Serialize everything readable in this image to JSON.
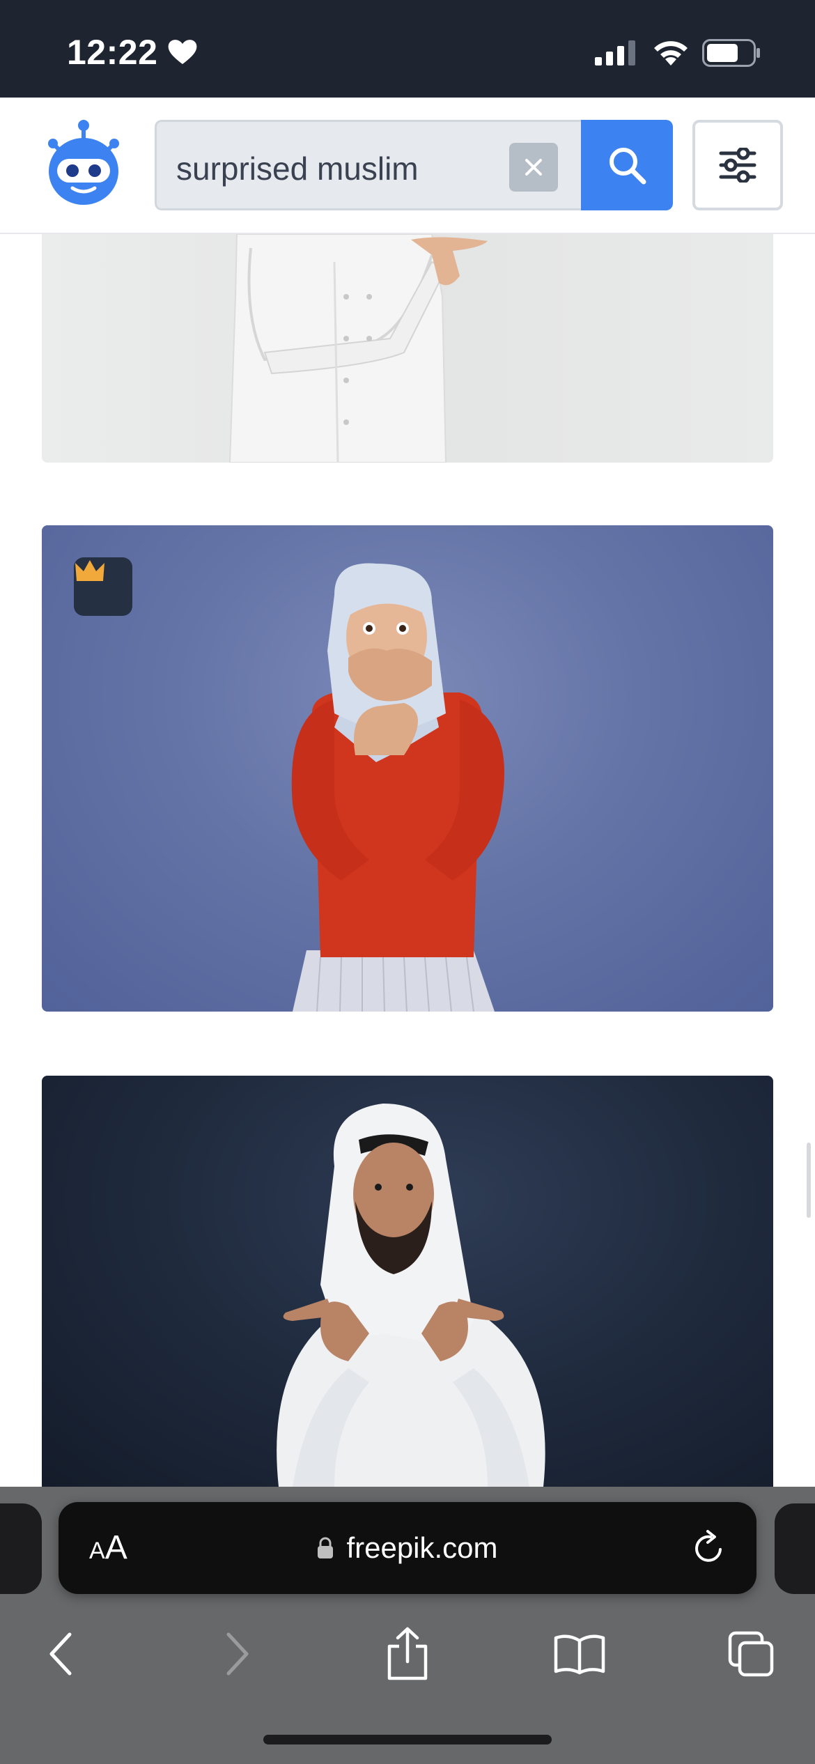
{
  "status_bar": {
    "time": "12:22",
    "icons": [
      "heart-icon",
      "cellular-signal-icon",
      "wifi-icon",
      "battery-icon"
    ]
  },
  "header": {
    "logo_icon": "robot-logo-icon",
    "search": {
      "value": "surprised muslim",
      "clear_icon": "close-icon",
      "submit_icon": "search-icon"
    },
    "filter_icon": "sliders-icon",
    "colors": {
      "accent": "#3c82f0",
      "header_bg": "#ffffff",
      "status_bg": "#1e2430"
    }
  },
  "results": [
    {
      "premium": false,
      "badge_icon": null
    },
    {
      "premium": true,
      "badge_icon": "crown-icon",
      "badge_color": "#f0a93a"
    },
    {
      "premium": false,
      "badge_icon": null
    }
  ],
  "browser": {
    "text_size_label_small": "A",
    "text_size_label_big": "A",
    "url": "freepik.com",
    "icons": [
      "lock-icon",
      "reload-icon",
      "back-icon",
      "forward-icon",
      "share-icon",
      "bookmarks-icon",
      "tabs-icon"
    ],
    "forward_enabled": false
  }
}
